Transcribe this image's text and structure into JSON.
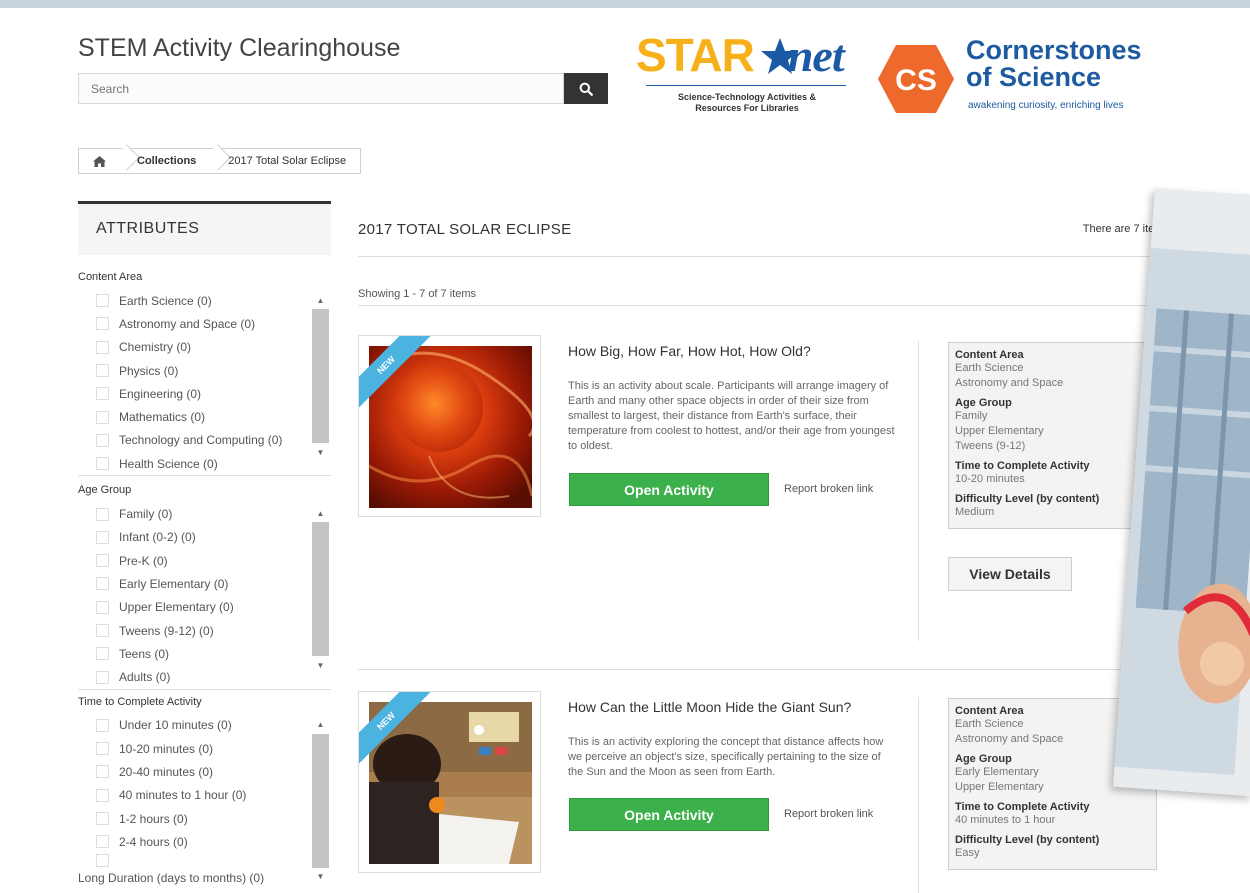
{
  "header": {
    "site_title": "STEM Activity Clearinghouse",
    "search_placeholder": "Search",
    "starnet": {
      "brand_a": "STAR",
      "brand_b": "net",
      "subtitle_1": "Science-Technology Activities &",
      "subtitle_2": "Resources For Libraries"
    },
    "cos": {
      "name_1": "Cornerstones",
      "name_2": "of Science",
      "hex_text": "CS",
      "tagline": "awakening curiosity, enriching lives"
    }
  },
  "breadcrumb": {
    "home_icon": "home-icon",
    "items": [
      "Collections",
      "2017 Total Solar Eclipse"
    ]
  },
  "sidebar": {
    "heading": "ATTRIBUTES",
    "facets": [
      {
        "title": "Content Area",
        "options": [
          "Earth Science (0)",
          "Astronomy and Space (0)",
          "Chemistry (0)",
          "Physics (0)",
          "Engineering (0)",
          "Mathematics (0)",
          "Technology and Computing (0)",
          "Health Science (0)"
        ]
      },
      {
        "title": "Age Group",
        "options": [
          "Family (0)",
          "Infant (0-2) (0)",
          "Pre-K (0)",
          "Early Elementary (0)",
          "Upper Elementary (0)",
          "Tweens (9-12) (0)",
          "Teens (0)",
          "Adults (0)"
        ]
      },
      {
        "title": "Time to Complete Activity",
        "options": [
          "Under 10 minutes (0)",
          "10-20 minutes (0)",
          "20-40 minutes (0)",
          "40 minutes to 1 hour (0)",
          "1-2 hours (0)",
          "2-4 hours (0)",
          "Long Duration (days to months) (0)"
        ]
      }
    ]
  },
  "content": {
    "title": "2017 TOTAL SOLAR ECLIPSE",
    "count": "There are 7 items.",
    "showing": "Showing 1 - 7 of 7 items",
    "items": [
      {
        "ribbon": "NEW",
        "title": "How Big, How Far, How Hot, How Old?",
        "description": "This is an activity about scale. Participants will arrange imagery of Earth and many other space objects in order of their size from smallest to largest, their distance from Earth's surface, their temperature from coolest to hottest, and/or their age from youngest to oldest.",
        "open_label": "Open Activity",
        "report_label": "Report broken link",
        "meta": {
          "content_area_label": "Content Area",
          "content_area": [
            "Earth Science",
            "Astronomy and Space"
          ],
          "age_group_label": "Age Group",
          "age_group": [
            "Family",
            "Upper Elementary",
            "Tweens (9-12)"
          ],
          "time_label": "Time to Complete Activity",
          "time": "10-20 minutes",
          "difficulty_label": "Difficulty Level (by content)",
          "difficulty": "Medium"
        },
        "details_label": "View Details"
      },
      {
        "ribbon": "NEW",
        "title": "How Can the Little Moon Hide the Giant Sun?",
        "description": "This is an activity exploring the concept that distance affects how we perceive an object's size, specifically pertaining to the size of the Sun and the Moon as seen from Earth.",
        "open_label": "Open Activity",
        "report_label": "Report broken link",
        "meta": {
          "content_area_label": "Content Area",
          "content_area": [
            "Earth Science",
            "Astronomy and Space"
          ],
          "age_group_label": "Age Group",
          "age_group": [
            "Early Elementary",
            "Upper Elementary"
          ],
          "time_label": "Time to Complete Activity",
          "time": "40 minutes to 1 hour",
          "difficulty_label": "Difficulty Level (by content)",
          "difficulty": "Easy"
        }
      }
    ]
  },
  "colors": {
    "green_button": "#3cb04a",
    "ribbon_blue": "#4ab3e0",
    "starnet_yellow": "#f7b019",
    "brand_blue": "#1d5aa0",
    "cos_orange": "#ee6a2c"
  }
}
